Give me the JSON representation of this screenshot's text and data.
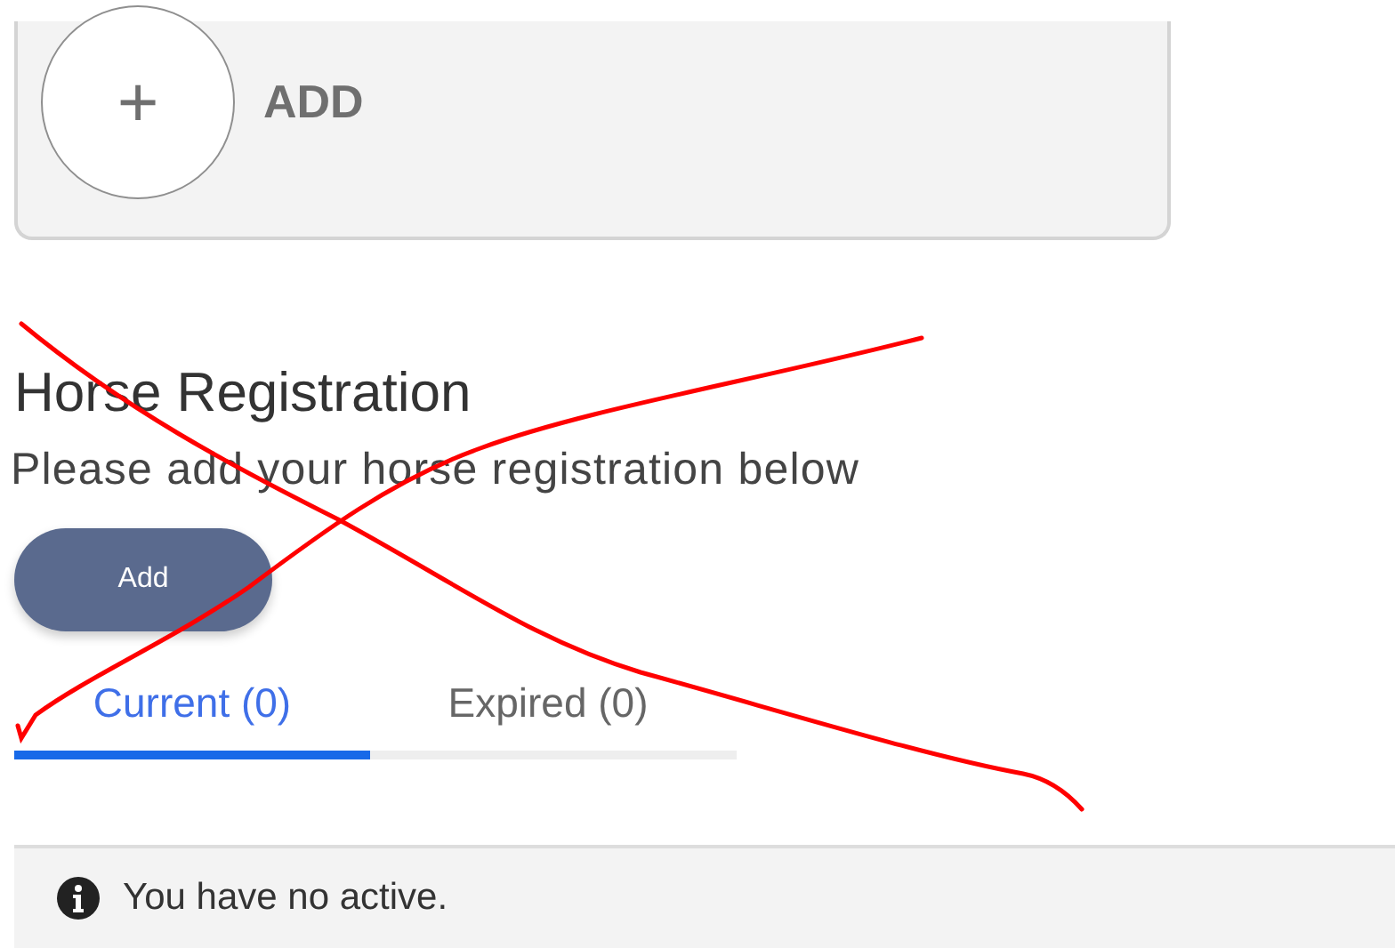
{
  "add_card": {
    "icon": "+",
    "label": "ADD"
  },
  "section": {
    "title": "Horse Registration",
    "subtitle": "Please add your horse registration below"
  },
  "add_button": {
    "label": "Add"
  },
  "tabs": [
    {
      "label": "Current (0)",
      "selected": true
    },
    {
      "label": "Expired (0)",
      "selected": false
    }
  ],
  "notice": {
    "text": "You have no active."
  }
}
